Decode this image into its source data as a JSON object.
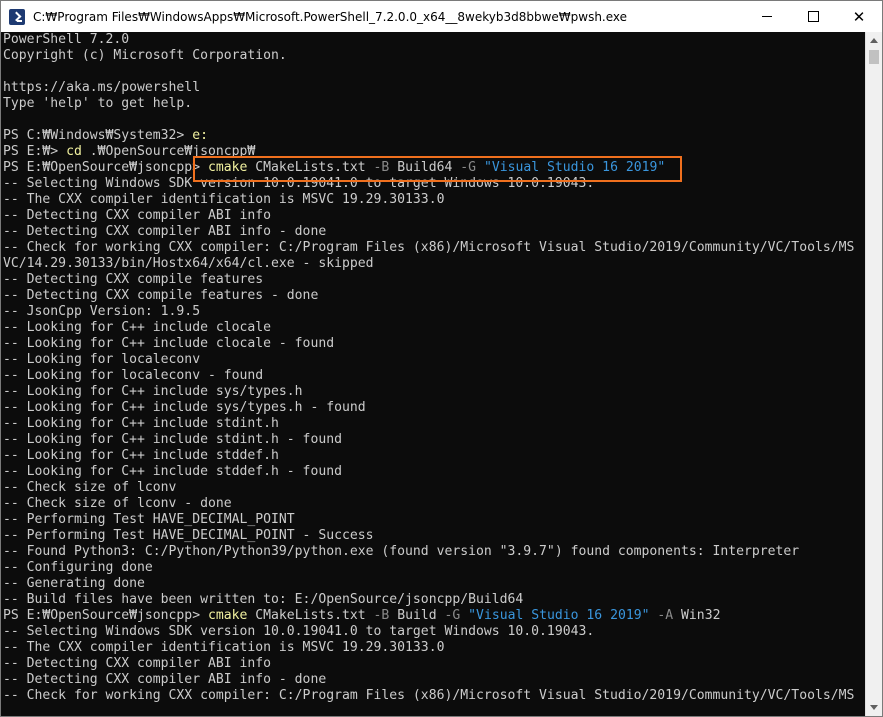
{
  "window": {
    "title": "C:₩Program Files₩WindowsApps₩Microsoft.PowerShell_7.2.0.0_x64__8wekyb3d8bbwe₩pwsh.exe",
    "minimize_label": "",
    "maximize_label": "",
    "close_label": "✕"
  },
  "colors": {
    "background": "#0c0c0c",
    "text": "#cccccc",
    "parameter": "#8a8a8a",
    "string": "#3a96dd",
    "command": "#f2f2a0",
    "highlight": "#f0701e"
  },
  "terminal": {
    "lines": [
      [
        {
          "t": "PowerShell 7.2.0",
          "c": ""
        }
      ],
      [
        {
          "t": "Copyright (c) Microsoft Corporation.",
          "c": ""
        }
      ],
      [
        {
          "t": "",
          "c": ""
        }
      ],
      [
        {
          "t": "https://aka.ms/powershell",
          "c": ""
        }
      ],
      [
        {
          "t": "Type 'help' to get help.",
          "c": ""
        }
      ],
      [
        {
          "t": "",
          "c": ""
        }
      ],
      [
        {
          "t": "PS C:₩Windows₩System32> ",
          "c": ""
        },
        {
          "t": "e:",
          "c": "cmd"
        }
      ],
      [
        {
          "t": "PS E:₩> ",
          "c": ""
        },
        {
          "t": "cd",
          "c": "cmd"
        },
        {
          "t": " .₩OpenSource₩jsoncpp₩",
          "c": ""
        }
      ],
      [
        {
          "t": "PS E:₩OpenSource₩jsoncpp> ",
          "c": ""
        },
        {
          "t": "cmake",
          "c": "cmd"
        },
        {
          "t": " CMakeLists.txt ",
          "c": ""
        },
        {
          "t": "-B",
          "c": "param"
        },
        {
          "t": " Build64 ",
          "c": ""
        },
        {
          "t": "-G",
          "c": "param"
        },
        {
          "t": " ",
          "c": ""
        },
        {
          "t": "\"Visual Studio 16 2019\"",
          "c": "string"
        }
      ],
      [
        {
          "t": "-- Selecting Windows SDK version 10.0.19041.0 to target Windows 10.0.19043.",
          "c": ""
        }
      ],
      [
        {
          "t": "-- The CXX compiler identification is MSVC 19.29.30133.0",
          "c": ""
        }
      ],
      [
        {
          "t": "-- Detecting CXX compiler ABI info",
          "c": ""
        }
      ],
      [
        {
          "t": "-- Detecting CXX compiler ABI info - done",
          "c": ""
        }
      ],
      [
        {
          "t": "-- Check for working CXX compiler: C:/Program Files (x86)/Microsoft Visual Studio/2019/Community/VC/Tools/MS",
          "c": ""
        }
      ],
      [
        {
          "t": "VC/14.29.30133/bin/Hostx64/x64/cl.exe - skipped",
          "c": ""
        }
      ],
      [
        {
          "t": "-- Detecting CXX compile features",
          "c": ""
        }
      ],
      [
        {
          "t": "-- Detecting CXX compile features - done",
          "c": ""
        }
      ],
      [
        {
          "t": "-- JsonCpp Version: 1.9.5",
          "c": ""
        }
      ],
      [
        {
          "t": "-- Looking for C++ include clocale",
          "c": ""
        }
      ],
      [
        {
          "t": "-- Looking for C++ include clocale - found",
          "c": ""
        }
      ],
      [
        {
          "t": "-- Looking for localeconv",
          "c": ""
        }
      ],
      [
        {
          "t": "-- Looking for localeconv - found",
          "c": ""
        }
      ],
      [
        {
          "t": "-- Looking for C++ include sys/types.h",
          "c": ""
        }
      ],
      [
        {
          "t": "-- Looking for C++ include sys/types.h - found",
          "c": ""
        }
      ],
      [
        {
          "t": "-- Looking for C++ include stdint.h",
          "c": ""
        }
      ],
      [
        {
          "t": "-- Looking for C++ include stdint.h - found",
          "c": ""
        }
      ],
      [
        {
          "t": "-- Looking for C++ include stddef.h",
          "c": ""
        }
      ],
      [
        {
          "t": "-- Looking for C++ include stddef.h - found",
          "c": ""
        }
      ],
      [
        {
          "t": "-- Check size of lconv",
          "c": ""
        }
      ],
      [
        {
          "t": "-- Check size of lconv - done",
          "c": ""
        }
      ],
      [
        {
          "t": "-- Performing Test HAVE_DECIMAL_POINT",
          "c": ""
        }
      ],
      [
        {
          "t": "-- Performing Test HAVE_DECIMAL_POINT - Success",
          "c": ""
        }
      ],
      [
        {
          "t": "-- Found Python3: C:/Python/Python39/python.exe (found version \"3.9.7\") found components: Interpreter",
          "c": ""
        }
      ],
      [
        {
          "t": "-- Configuring done",
          "c": ""
        }
      ],
      [
        {
          "t": "-- Generating done",
          "c": ""
        }
      ],
      [
        {
          "t": "-- Build files have been written to: E:/OpenSource/jsoncpp/Build64",
          "c": ""
        }
      ],
      [
        {
          "t": "PS E:₩OpenSource₩jsoncpp> ",
          "c": ""
        },
        {
          "t": "cmake",
          "c": "cmd"
        },
        {
          "t": " CMakeLists.txt ",
          "c": ""
        },
        {
          "t": "-B",
          "c": "param"
        },
        {
          "t": " Build ",
          "c": ""
        },
        {
          "t": "-G",
          "c": "param"
        },
        {
          "t": " ",
          "c": ""
        },
        {
          "t": "\"Visual Studio 16 2019\"",
          "c": "string"
        },
        {
          "t": " ",
          "c": ""
        },
        {
          "t": "-A",
          "c": "param"
        },
        {
          "t": " Win32",
          "c": ""
        }
      ],
      [
        {
          "t": "-- Selecting Windows SDK version 10.0.19041.0 to target Windows 10.0.19043.",
          "c": ""
        }
      ],
      [
        {
          "t": "-- The CXX compiler identification is MSVC 19.29.30133.0",
          "c": ""
        }
      ],
      [
        {
          "t": "-- Detecting CXX compiler ABI info",
          "c": ""
        }
      ],
      [
        {
          "t": "-- Detecting CXX compiler ABI info - done",
          "c": ""
        }
      ],
      [
        {
          "t": "-- Check for working CXX compiler: C:/Program Files (x86)/Microsoft Visual Studio/2019/Community/VC/Tools/MS",
          "c": ""
        }
      ]
    ]
  }
}
